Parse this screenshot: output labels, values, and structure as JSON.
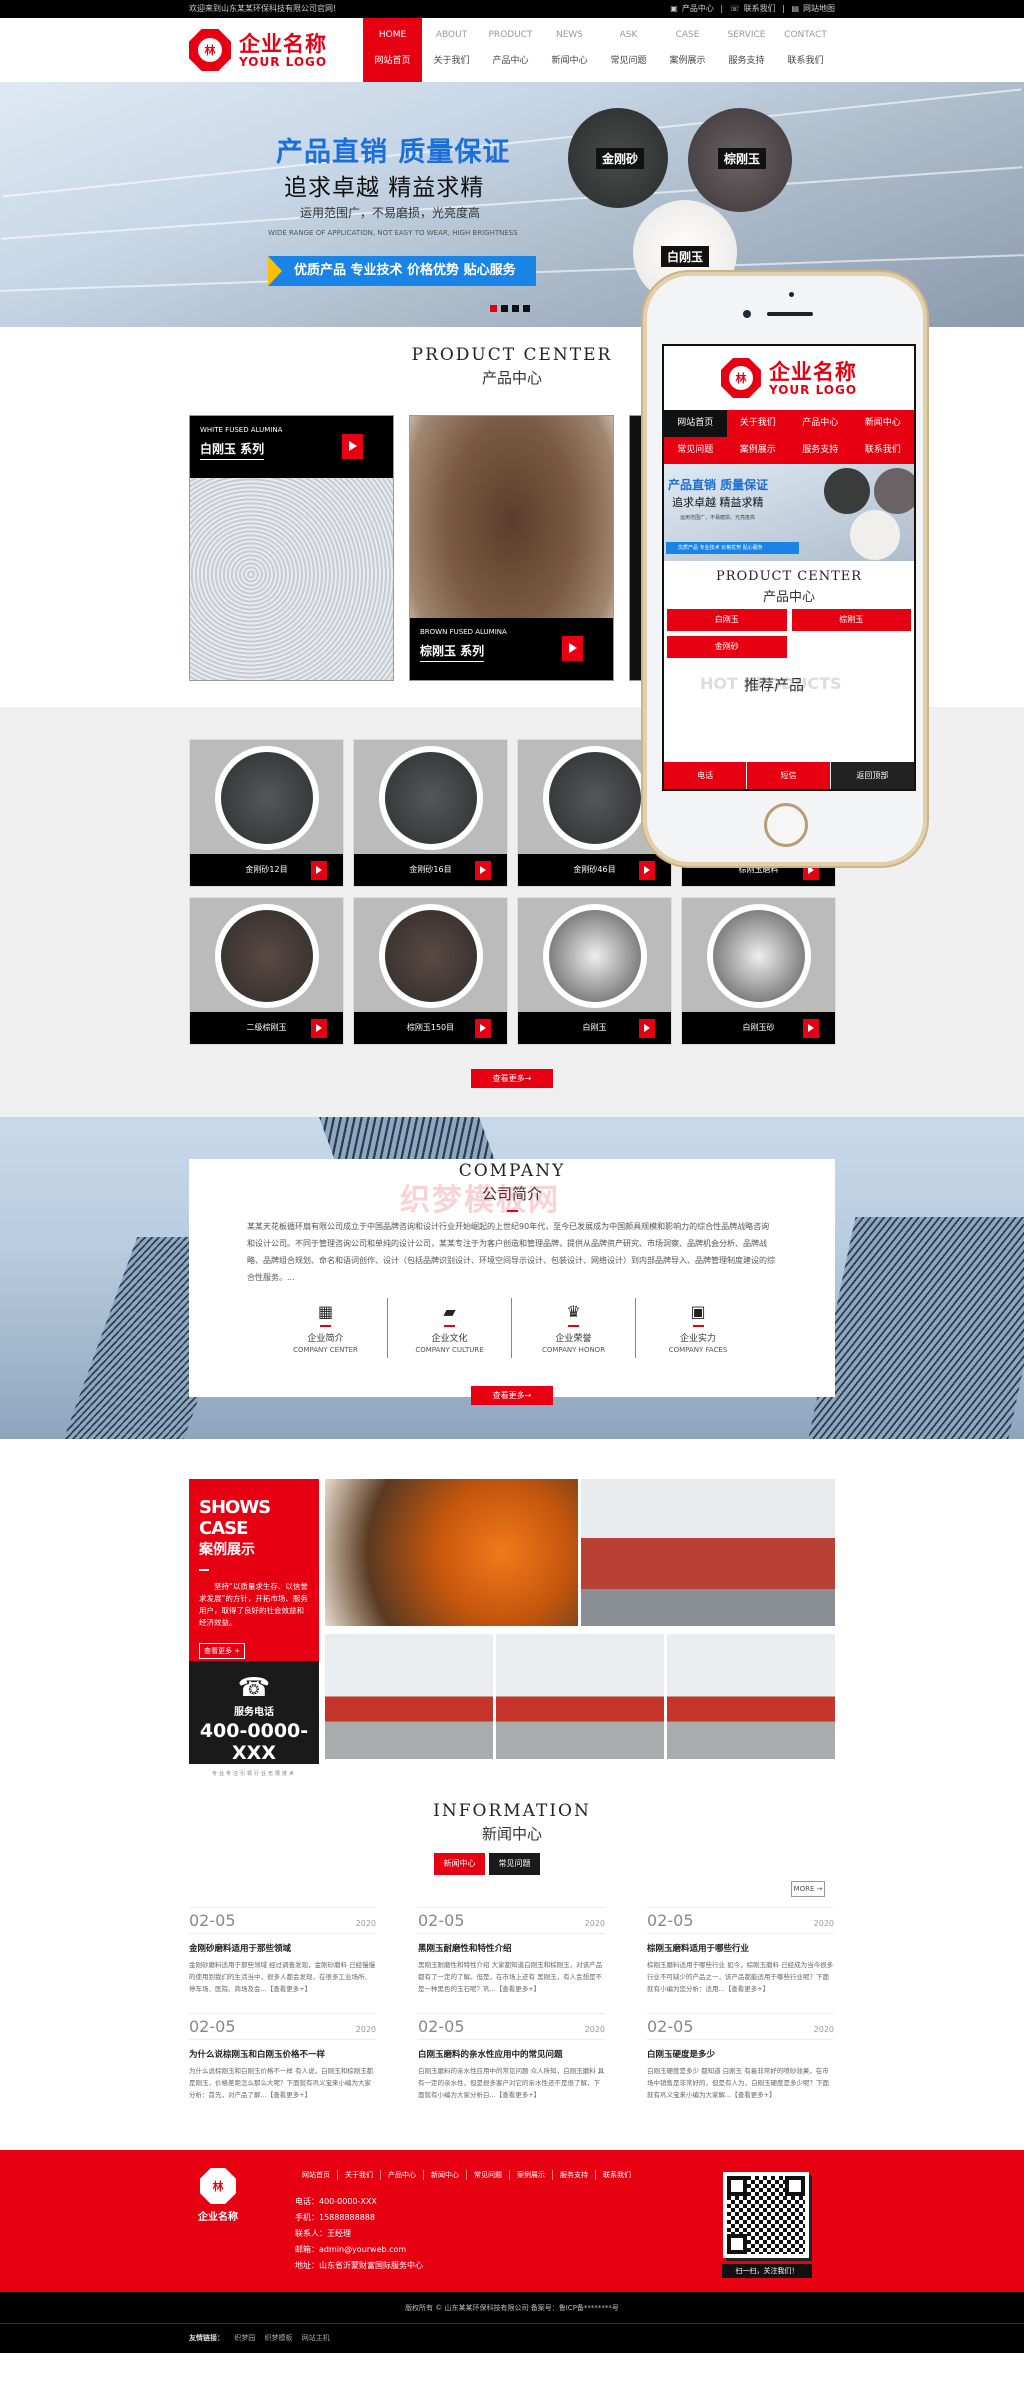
{
  "topbar": {
    "welcome": "欢迎来到山东某某环保科技有限公司官网!",
    "links": [
      {
        "icon": "box-icon",
        "label": "产品中心"
      },
      {
        "icon": "phone-icon",
        "label": "联系我们"
      },
      {
        "icon": "sitemap-icon",
        "label": "网站地图"
      }
    ]
  },
  "logo": {
    "cn": "企业名称",
    "en": "YOUR LOGO",
    "mark": "林"
  },
  "nav": [
    {
      "en": "HOME",
      "cn": "网站首页",
      "active": true
    },
    {
      "en": "ABOUT",
      "cn": "关于我们"
    },
    {
      "en": "PRODUCT",
      "cn": "产品中心"
    },
    {
      "en": "NEWS",
      "cn": "新闻中心"
    },
    {
      "en": "ASK",
      "cn": "常见问题"
    },
    {
      "en": "CASE",
      "cn": "案例展示"
    },
    {
      "en": "SERVICE",
      "cn": "服务支持"
    },
    {
      "en": "CONTACT",
      "cn": "联系我们"
    }
  ],
  "banner": {
    "title": "产品直销 质量保证",
    "subtitle": "追求卓越 精益求精",
    "tagline": "运用范围广，不易磨损，光亮度高",
    "tagline_en": "WIDE RANGE OF APPLICATION, NOT EASY TO WEAR, HIGH BRIGHTNESS",
    "cta": "优质产品 专业技术 价格优势 贴心服务",
    "grits": [
      "金刚砂",
      "棕刚玉",
      "白刚玉"
    ],
    "slides": 4,
    "active_slide": 1
  },
  "product_center": {
    "title_en": "PRODUCT CENTER",
    "title_cn": "产品中心",
    "categories": [
      {
        "en": "WHITE FUSED ALUMINA",
        "cn": "白刚玉 系列"
      },
      {
        "en": "BROWN FUSED ALUMINA",
        "cn": "棕刚玉 系列"
      }
    ]
  },
  "hot": {
    "ghost": "HOT PRODUCTS",
    "title_cn": "推荐产品",
    "items": [
      {
        "name": "金刚砂12目",
        "color": "#55575a"
      },
      {
        "name": "金刚砂16目",
        "color": "#55575a"
      },
      {
        "name": "金刚砂46目",
        "color": "#55575a"
      },
      {
        "name": "棕刚玉磨料",
        "color": "#5a4a44"
      },
      {
        "name": "二级棕刚玉",
        "color": "#5a4a44"
      },
      {
        "name": "棕刚玉150目",
        "color": "#5a4a44"
      },
      {
        "name": "白刚玉",
        "color": "#eeeeee"
      },
      {
        "name": "白刚玉砂",
        "color": "#eeeeee"
      }
    ],
    "more": "查看更多→"
  },
  "company": {
    "title_en": "COMPANY",
    "title_cn": "公司简介",
    "text": "某某天花板循环扇有限公司成立于中国品牌咨询和设计行业开始崛起的上世纪90年代，至今已发展成为中国颇具规模和影响力的综合性品牌战略咨询和设计公司。不同于管理咨询公司和单纯的设计公司，某某专注于为客户创造和管理品牌，提供从品牌资产研究、市场洞察、品牌机会分析、品牌战略、品牌组合规划、命名和语词创作、设计（包括品牌识别设计、环境空间导示设计、包装设计、网络设计）到内部品牌导入、品牌管理制度建设的综合性服务。...",
    "features": [
      {
        "icon": "building-icon",
        "glyph": "▦",
        "cn": "企业简介",
        "en": "COMPANY CENTER"
      },
      {
        "icon": "book-icon",
        "glyph": "▰",
        "cn": "企业文化",
        "en": "COMPANY CULTURE"
      },
      {
        "icon": "trophy-icon",
        "glyph": "♛",
        "cn": "企业荣誉",
        "en": "COMPANY HONOR"
      },
      {
        "icon": "film-icon",
        "glyph": "▣",
        "cn": "企业实力",
        "en": "COMPANY FACES"
      }
    ],
    "more": "查看更多→"
  },
  "watermark": "织梦模板网",
  "case": {
    "title_en": "SHOWS CASE",
    "title_cn": "案例展示",
    "desc": "坚持“以质量求生存、以信誉求发展”的方针，开拓市场、服务用户，取得了良好的社会效益和经济效益。",
    "more": "查看更多 +",
    "service_label": "服务电话",
    "phone": "400-0000-XXX",
    "slogan": "专业专注引领行业无限技术"
  },
  "news": {
    "title_en": "INFORMATION",
    "title_cn": "新闻中心",
    "tabs": [
      {
        "label": "新闻中心",
        "active": true
      },
      {
        "label": "常见问题"
      }
    ],
    "more": "MORE →",
    "items": [
      {
        "md": "02-05",
        "year": "2020",
        "title": "金刚砂磨料适用于那些领域",
        "summary": "金刚砂磨料适用于那些领域 经过调查发现，金刚砂磨料 已经慢慢的使用到我们的生活当中，很多人都会发现，在很多工业场所、停车场、医院、商场及会...【查看更多+】"
      },
      {
        "md": "02-05",
        "year": "2020",
        "title": "为什么说棕刚玉和白刚玉价格不一样",
        "summary": "为什么说棕刚玉和白刚玉价格不一样 有人说，白刚玉和棕刚玉都是刚玉，价格差距怎么那么大呢？下面就有巩义宝来小编为大家分析：首先，对产品了解...【查看更多+】"
      },
      {
        "md": "02-05",
        "year": "2020",
        "title": "黑刚玉耐磨性和特性介绍",
        "summary": "黑刚玉耐磨性和特性介绍 大家都知道白刚玉和棕刚玉，对该产品都有了一定的了解。但是，在市场上还有 黑刚玉，有人会想是不是一种黑色的玉石呢？巩...【查看更多+】"
      },
      {
        "md": "02-05",
        "year": "2020",
        "title": "白刚玉磨料的亲水性应用中的常见问题",
        "summary": "白刚玉磨料的亲水性应用中的常见问题 众人所知，白刚玉磨料 具有一定的亲水性，但是很多客户对它的亲水性还不是很了解，下面就有小编为大家分析白...【查看更多+】"
      },
      {
        "md": "02-05",
        "year": "2020",
        "title": "棕刚玉磨料适用于哪些行业",
        "summary": "棕刚玉磨料适用于哪些行业 如今，棕刚玉磨料 已经成为当今很多行业不可缺少的产品之一，该产品都能适用于哪些行业呢？下面就有小编为您分析：适用...【查看更多+】"
      },
      {
        "md": "02-05",
        "year": "2020",
        "title": "白刚玉硬度是多少",
        "summary": "白刚玉硬度是多少 都知道 白刚玉 有着非常好的喷砂效果，在市场中销售是非常好的，但是有人为，白刚玉硬度是多少呢？下面就有巩义宝来小编为大家解...【查看更多+】"
      }
    ]
  },
  "footer": {
    "name": "企业名称",
    "nav": [
      "网站首页",
      "关于我们",
      "产品中心",
      "新闻中心",
      "常见问题",
      "案例展示",
      "服务支持",
      "联系我们"
    ],
    "info": [
      "电话：400-0000-XXX",
      "手机：15888888888",
      "联系人：王经理",
      "邮箱：admin@yourweb.com",
      "地址：山东省沂蒙财富国际服务中心"
    ],
    "qr_caption": "扫一扫，关注我们！",
    "copyright": "版权所有 © 山东某某环保科技有限公司 备案号：鲁ICP备********号",
    "friend_label": "友情链接：",
    "friends": [
      "织梦园",
      "织梦模板",
      "网站主机"
    ]
  },
  "phone_mock": {
    "nav": [
      "网站首页",
      "关于我们",
      "产品中心",
      "新闻中心",
      "常见问题",
      "案例展示",
      "服务支持",
      "联系我们"
    ],
    "banner_title": "产品直销 质量保证",
    "banner_sub": "追求卓越 精益求精",
    "banner_tag": "运用范围广，不易磨损，光亮度高",
    "banner_cta": "优质产品 专业技术 价格优势 贴心服务",
    "pc_en": "PRODUCT CENTER",
    "pc_cn": "产品中心",
    "cats": [
      "白刚玉",
      "棕刚玉",
      "金刚砂"
    ],
    "hot_ghost": "HOT PRODUCTS",
    "hot_cn": "推荐产品",
    "bottom": [
      "电话",
      "短信",
      "返回顶部"
    ]
  }
}
